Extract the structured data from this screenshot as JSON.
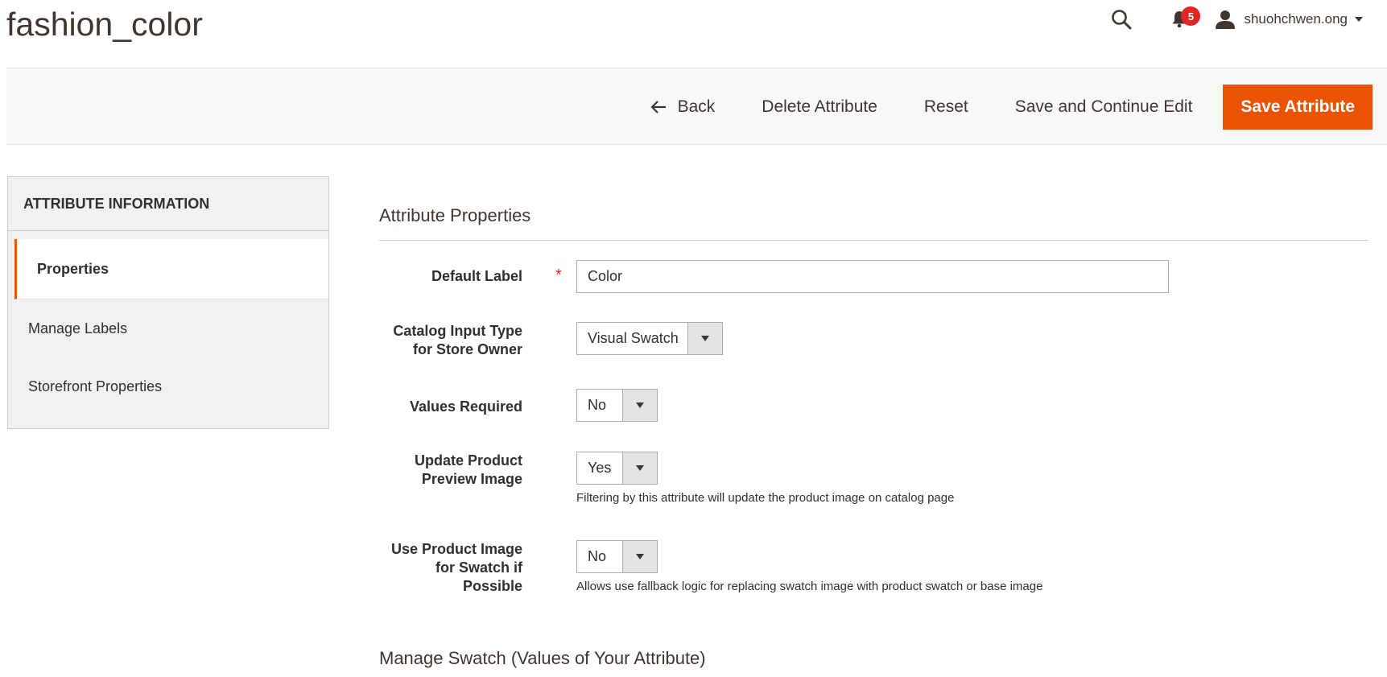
{
  "page": {
    "title": "fashion_color"
  },
  "header": {
    "notifications_count": "5",
    "user_name": "shuohchwen.ong"
  },
  "actions": {
    "back": "Back",
    "delete": "Delete Attribute",
    "reset": "Reset",
    "save_continue": "Save and Continue Edit",
    "save": "Save Attribute"
  },
  "sidebar": {
    "title": "ATTRIBUTE INFORMATION",
    "items": [
      {
        "label": "Properties",
        "active": true
      },
      {
        "label": "Manage Labels",
        "active": false
      },
      {
        "label": "Storefront Properties",
        "active": false
      }
    ]
  },
  "form": {
    "section_title": "Attribute Properties",
    "default_label": {
      "label": "Default Label",
      "required": "*",
      "value": "Color"
    },
    "catalog_input_type": {
      "label_line1": "Catalog Input Type",
      "label_line2": "for Store Owner",
      "value": "Visual Swatch"
    },
    "values_required": {
      "label": "Values Required",
      "value": "No"
    },
    "update_preview": {
      "label_line1": "Update Product",
      "label_line2": "Preview Image",
      "value": "Yes",
      "note": "Filtering by this attribute will update the product image on catalog page"
    },
    "use_product_image": {
      "label_line1": "Use Product Image",
      "label_line2": "for Swatch if",
      "label_line3": "Possible",
      "value": "No",
      "note": "Allows use fallback logic for replacing swatch image with product swatch or base image"
    },
    "manage_swatch_title": "Manage Swatch (Values of Your Attribute)"
  },
  "colors": {
    "primary": "#eb5202",
    "badge": "#e22626",
    "sidebar_bg": "#f1f1f1",
    "action_bar_bg": "#f8f8f8"
  }
}
